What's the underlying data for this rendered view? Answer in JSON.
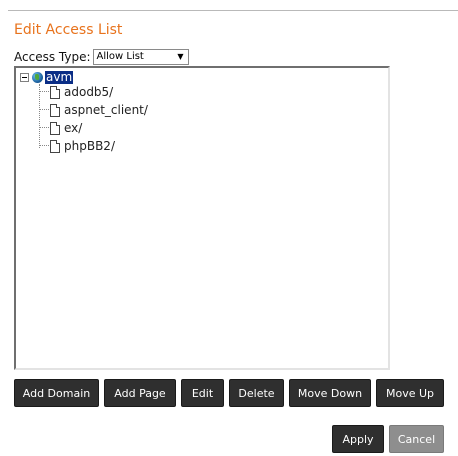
{
  "dialog": {
    "title": "Edit Access List"
  },
  "access_type": {
    "label": "Access Type:",
    "selected": "Allow List",
    "caret": "▼"
  },
  "tree": {
    "root": {
      "label": "avm",
      "icon": "globe-icon",
      "expanded": true,
      "selected": true
    },
    "items": [
      {
        "label": "adodb5/",
        "icon": "document-icon"
      },
      {
        "label": "aspnet_client/",
        "icon": "document-icon"
      },
      {
        "label": "ex/",
        "icon": "document-icon"
      },
      {
        "label": "phpBB2/",
        "icon": "document-icon"
      }
    ]
  },
  "toolbar": {
    "add_domain": "Add Domain",
    "add_page": "Add Page",
    "edit": "Edit",
    "delete": "Delete",
    "move_down": "Move Down",
    "move_up": "Move Up"
  },
  "footer": {
    "apply": "Apply",
    "cancel": "Cancel"
  },
  "colors": {
    "title": "#e8731d",
    "button_bg": "#2f2f2f",
    "button_disabled_bg": "#8e8e8e",
    "selection_bg": "#0a2d86"
  }
}
